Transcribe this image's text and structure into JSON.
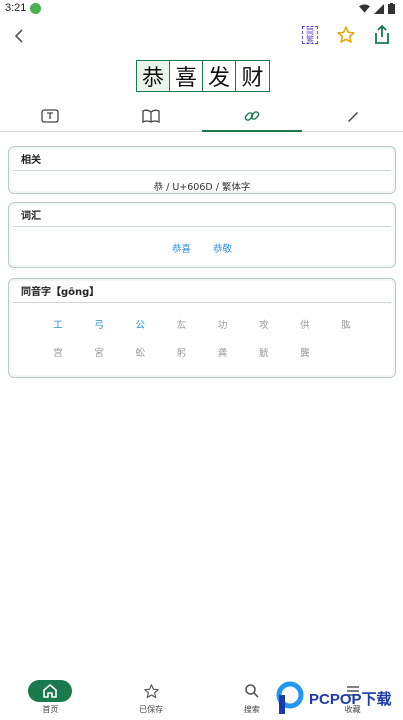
{
  "status": {
    "time": "3:21"
  },
  "toolbar": {
    "simp_trad_top": "简",
    "simp_trad_bottom": "繁"
  },
  "title": {
    "chars": [
      "恭",
      "喜",
      "发",
      "财"
    ]
  },
  "tabs": [
    "text",
    "book",
    "link",
    "pen"
  ],
  "related": {
    "heading": "相关",
    "text": "恭 / U+606D / 繁体字"
  },
  "vocab": {
    "heading": "词汇",
    "items": [
      "恭喜",
      "恭敬"
    ]
  },
  "homophones": {
    "heading": "同音字【gōng】",
    "row1": [
      "工",
      "弓",
      "公",
      "厷",
      "功",
      "攻",
      "供",
      "肱"
    ],
    "row2": [
      "宫",
      "宮",
      "蚣",
      "躬",
      "龚",
      "觥",
      "龔"
    ]
  },
  "nav": {
    "home": "首页",
    "saved": "已保存",
    "search": "搜索",
    "collect": "收藏"
  },
  "watermark": {
    "text": "PCPOP下载"
  },
  "colors": {
    "accent": "#1a7a4d",
    "link": "#2a8fd6",
    "muted": "#9a9a9a"
  }
}
